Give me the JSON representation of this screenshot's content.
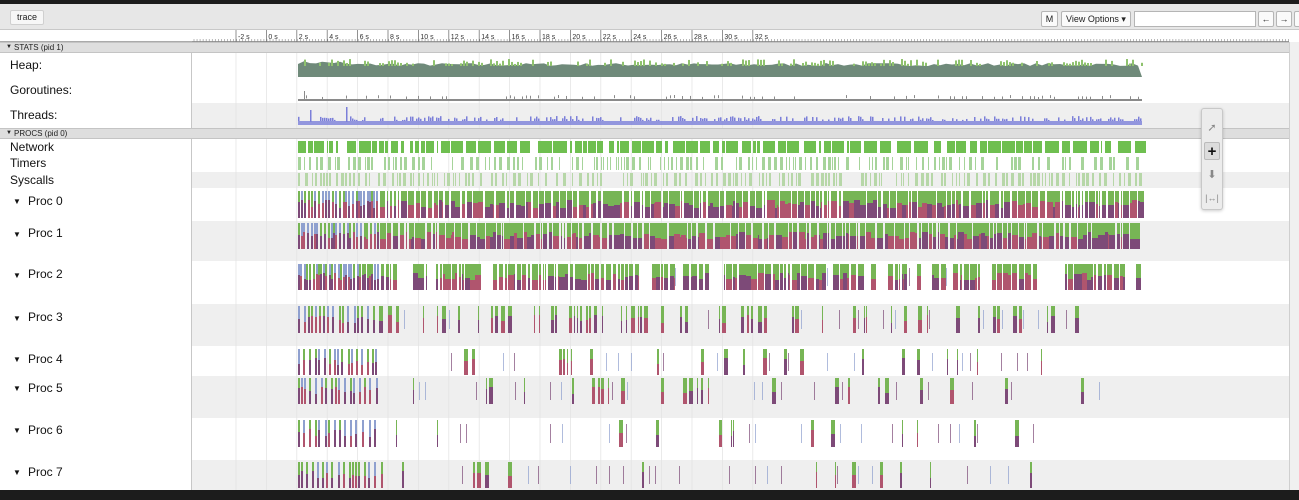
{
  "title": "trace",
  "toolbar": {
    "m_label": "M",
    "view_options_label": "View Options ▾",
    "search_placeholder": "",
    "prev_label": "←",
    "next_label": "→"
  },
  "ruler": {
    "ticks": [
      "-2 s",
      "0 s",
      "2 s",
      "4 s",
      "6 s",
      "8 s",
      "10 s",
      "12 s",
      "14 s",
      "16 s",
      "18 s",
      "20 s",
      "22 s",
      "24 s",
      "26 s",
      "28 s",
      "30 s",
      "32 s"
    ]
  },
  "sections": {
    "stats": "STATS (pid 1)",
    "procs": "PROCS (pid 0)"
  },
  "stats_tracks": [
    "Heap:",
    "Goroutines:",
    "Threads:"
  ],
  "proc_tracks": [
    "Network",
    "Timers",
    "Syscalls"
  ],
  "procs": [
    "Proc 0",
    "Proc 1",
    "Proc 2",
    "Proc 3",
    "Proc 4",
    "Proc 5",
    "Proc 6",
    "Proc 7"
  ],
  "colors": {
    "heap_fill": "#6f8a7a",
    "heap_alloc": "#8fc26e",
    "goroutines": "#8a8a8a",
    "threads": "#7b7fd9",
    "network": "#6fbf50",
    "timers": "#a6d49a",
    "syscalls": "#b7d7a8",
    "proc_green": "#77b555",
    "proc_purple": "#7d4a78",
    "proc_pink": "#b0556e",
    "proc_blue": "#8fa0cf",
    "grid": "#e2e2e2"
  },
  "mouse_tools": {
    "select": "select-cursor-icon",
    "pan": "pan-cross-icon",
    "zoom": "zoom-arrow-icon",
    "timing": "timing-icon"
  }
}
